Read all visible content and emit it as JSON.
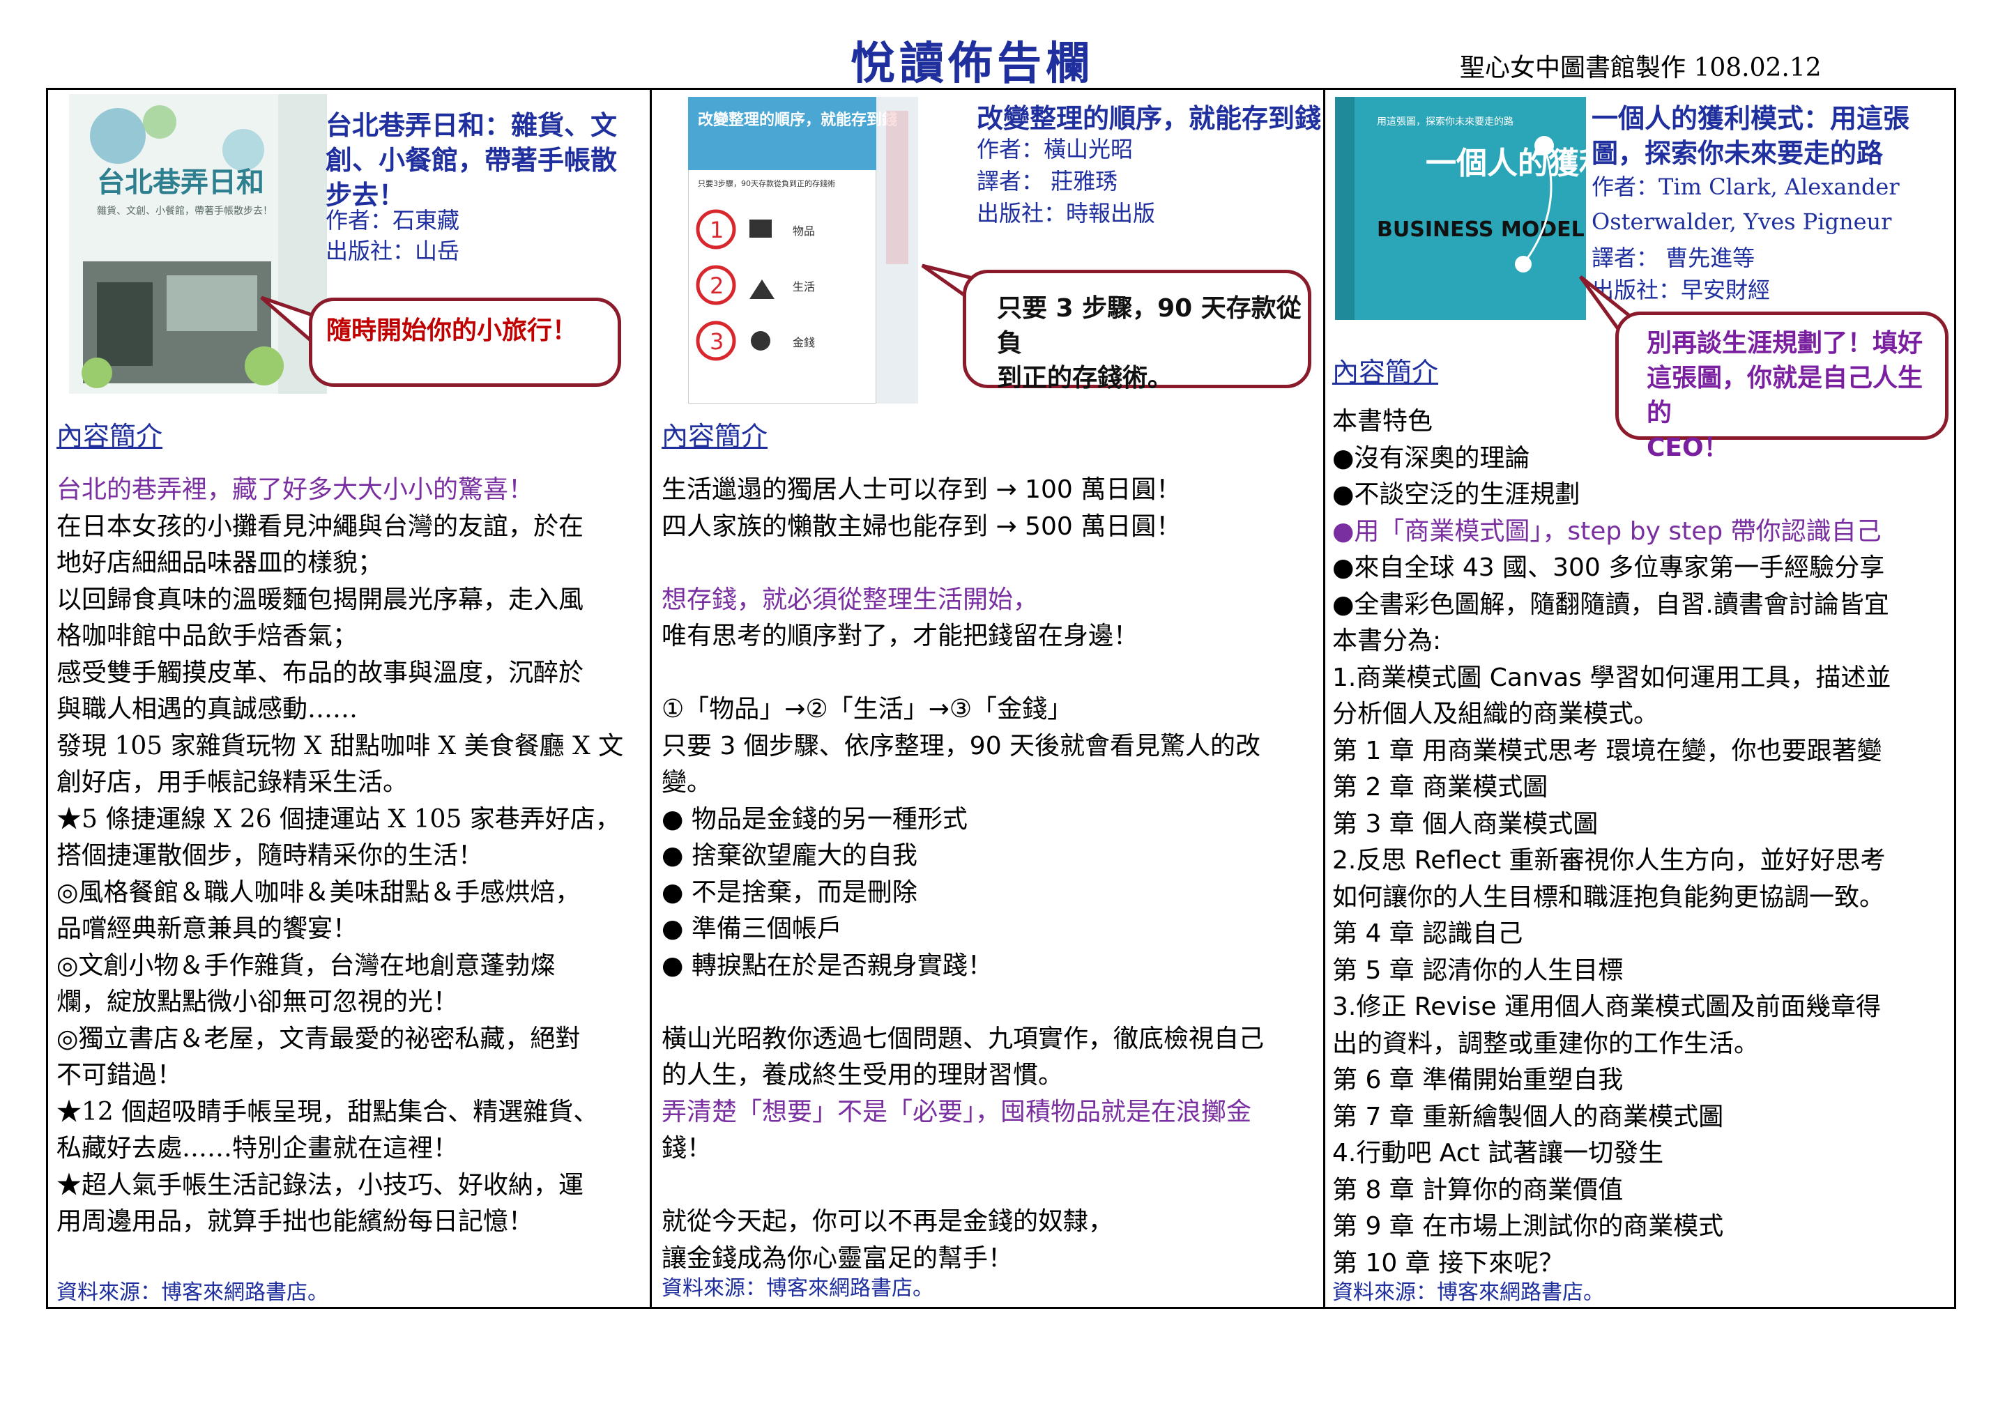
{
  "header": {
    "title": "悅讀佈告欄",
    "credit": "聖心女中圖書館製作 108.02.12"
  },
  "books": [
    {
      "cover_title": "台北巷弄日和",
      "cover_subtitle": "雜貨、文創、小餐館，帶著手帳散步去！",
      "title_lines": [
        "台北巷弄日和：雜貨、文",
        "創、小餐館，帶著手帳散",
        "步去！"
      ],
      "author": "作者：石東藏",
      "publisher": "出版社：山岳",
      "bubble": "隨時開始你的小旅行！",
      "intro_label": "內容簡介",
      "body_lines": [
        "台北的巷弄裡，藏了好多大大小小的驚喜！",
        "在日本女孩的小攤看見沖繩與台灣的友誼，於在",
        "地好店細細品味器皿的樣貌；",
        "以回歸食真味的溫暖麵包揭開晨光序幕，走入風",
        "格咖啡館中品飲手焙香氣；",
        "感受雙手觸摸皮革、布品的故事與溫度，沉醉於",
        "與職人相遇的真誠感動……",
        "發現 105 家雜貨玩物 X 甜點咖啡 X 美食餐廳 X 文",
        "創好店，用手帳記錄精采生活。",
        "★5 條捷運線 X 26 個捷運站 X 105 家巷弄好店，",
        "搭個捷運散個步，隨時精采你的生活！",
        "◎風格餐館＆職人咖啡＆美味甜點＆手感烘焙，",
        "品嚐經典新意兼具的饗宴！",
        "◎文創小物＆手作雜貨，台灣在地創意蓬勃燦",
        "爛，綻放點點微小卻無可忽視的光！",
        "◎獨立書店＆老屋，文青最愛的祕密私藏，絕對",
        "不可錯過！",
        "★12 個超吸睛手帳呈現，甜點集合、精選雜貨、",
        "私藏好去處……特別企畫就在這裡！",
        "★超人氣手帳生活記錄法，小技巧、好收納，運",
        "用周邊用品，就算手拙也能繽紛每日記憶！"
      ],
      "source": "資料來源：博客來網路書店。"
    },
    {
      "cover_title": "改變整理的順序，就能存到錢",
      "cover_subtitle": "只要3步驟，90天存款從負到正的存錢術",
      "cover_steps": [
        "物品",
        "生活",
        "金錢"
      ],
      "title": "改變整理的順序，就能存到錢",
      "author": "作者：橫山光昭",
      "translator": "譯者： 莊雅琇",
      "publisher": "出版社：時報出版",
      "bubble_lines": [
        "只要 3 步驟，90 天存款從負",
        "到正的存錢術。"
      ],
      "intro_label": "內容簡介",
      "body_lines": [
        "生活邋遢的獨居人士可以存到 → 100 萬日圓！",
        "四人家族的懶散主婦也能存到 → 500 萬日圓！",
        "",
        "想存錢，就必須從整理生活開始，",
        "唯有思考的順序對了，才能把錢留在身邊！",
        "",
        "①「物品」→②「生活」→③「金錢」",
        "只要 3 個步驟、依序整理，90 天後就會看見驚人的改",
        "變。",
        "●  物品是金錢的另一種形式",
        "●  捨棄欲望龐大的自我",
        "●  不是捨棄，而是刪除",
        "●  準備三個帳戶",
        "●  轉捩點在於是否親身實踐！",
        "",
        "橫山光昭教你透過七個問題、九項實作，徹底檢視自己",
        "的人生，養成終生受用的理財習慣。",
        "弄清楚「想要」不是「必要」，囤積物品就是在浪擲金",
        "錢！",
        "",
        "就從今天起，你可以不再是金錢的奴隸，",
        "讓金錢成為你心靈富足的幫手！"
      ],
      "source": "資料來源：博客來網路書店。"
    },
    {
      "cover_title": "一個人的獲利模式",
      "cover_english": "BUSINESS MODEL YOU",
      "cover_subtitle": "用這張圖，探索你未來要走的路",
      "title_lines": [
        "一個人的獲利模式：用這張",
        "圖，探索你未來要走的路"
      ],
      "author_lines": [
        "作者：Tim Clark, Alexander",
        "Osterwalder, Yves Pigneur"
      ],
      "translator": "譯者： 曹先進等",
      "publisher": "出版社：早安財經",
      "bubble_lines": [
        "別再談生涯規劃了！填好",
        "這張圖，你就是自己人生的",
        "CEO！"
      ],
      "intro_label": "內容簡介",
      "body_lines": [
        "本書特色",
        "●沒有深奧的理論",
        "●不談空泛的生涯規劃",
        "●用「商業模式圖」，step by step 帶你認識自己",
        "●來自全球 43 國、300 多位專家第一手經驗分享",
        "●全書彩色圖解，隨翻隨讀，自習.讀書會討論皆宜",
        "本書分為:",
        "1.商業模式圖 Canvas 學習如何運用工具，描述並",
        "分析個人及組織的商業模式。",
        "第 1 章  用商業模式思考  環境在變，你也要跟著變",
        "第 2 章  商業模式圖",
        "第 3 章  個人商業模式圖",
        "2.反思 Reflect 重新審視你人生方向，並好好思考",
        "如何讓你的人生目標和職涯抱負能夠更協調一致。",
        "第 4 章  認識自己",
        "第 5 章  認清你的人生目標",
        "3.修正 Revise 運用個人商業模式圖及前面幾章得",
        "出的資料，調整或重建你的工作生活。",
        "第 6 章    準備開始重塑自我",
        "第 7 章    重新繪製個人的商業模式圖",
        "4.行動吧 Act 試著讓一切發生",
        "第 8 章    計算你的商業價值",
        "第 9 章    在市場上測試你的商業模式",
        "第 10 章    接下來呢？"
      ],
      "source": "資料來源：博客來網路書店。"
    }
  ]
}
